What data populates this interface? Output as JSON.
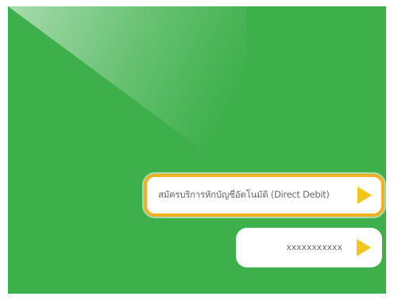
{
  "colors": {
    "background": "#3db04b",
    "button_border": "#f2b022",
    "arrow": "#f5c518",
    "label_text": "#6a6a6a"
  },
  "menu": {
    "primary_label": "สมัครบริการหักบัญชีอัตโนมัติ (Direct Debit)",
    "primary_icon": "play-arrow-icon",
    "secondary_label": "xxxxxxxxxxx",
    "secondary_icon": "play-arrow-icon"
  }
}
